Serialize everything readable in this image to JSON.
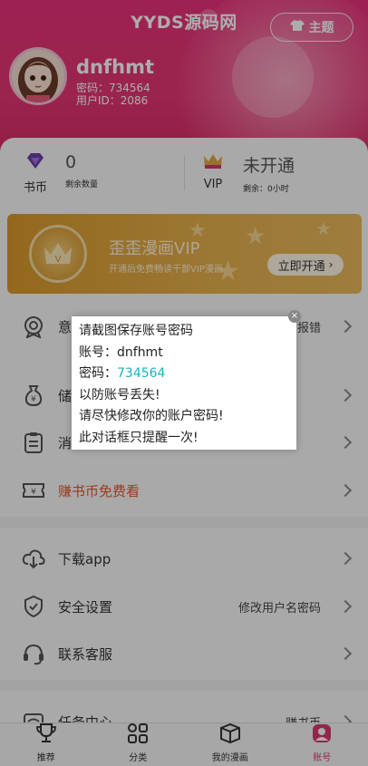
{
  "header": {
    "site_title": "YYDS源码网",
    "theme_label": "主题",
    "username": "dnfhmt",
    "password_line": "密码：734564",
    "user_id_line": "用户ID：2086"
  },
  "stats": {
    "coins": {
      "icon_label": "书币",
      "value": "0",
      "sub": "剩余数量"
    },
    "vip": {
      "icon_label": "VIP",
      "value": "未开通",
      "sub": "剩余：0小时"
    }
  },
  "vip_banner": {
    "title": "歪歪漫画VIP",
    "desc": "开通后免费畅读千部VIP漫画",
    "button": "立即开通"
  },
  "menu": [
    {
      "label": "意见反馈",
      "visible_label": "意",
      "right": "报错"
    },
    {
      "label": "储",
      "right": ""
    },
    {
      "label": "消",
      "right": ""
    },
    {
      "label": "赚书币免费看",
      "right": ""
    },
    {
      "label": "下载app",
      "right": ""
    },
    {
      "label": "安全设置",
      "right": "修改用户名密码"
    },
    {
      "label": "联系客服",
      "right": ""
    },
    {
      "label": "任务中心",
      "right": "赚书币"
    }
  ],
  "dialog": {
    "line1": "请截图保存账号密码",
    "account_prefix": "账号：",
    "account": "dnfhmt",
    "password_prefix": "密码：",
    "password": "734564",
    "line4": "以防账号丢失!",
    "line5": "请尽快修改你的账户密码!",
    "line6": "此对话框只提醒一次!"
  },
  "bottom_nav": [
    {
      "label": "推荐",
      "icon": "trophy-icon"
    },
    {
      "label": "分类",
      "icon": "category-icon"
    },
    {
      "label": "我的漫画",
      "icon": "book-icon"
    },
    {
      "label": "账号",
      "icon": "account-icon",
      "active": true
    }
  ],
  "colors": {
    "brand": "#e43574",
    "vip_gold": "#e0a944",
    "password_highlight": "#1bb0c4",
    "earn_coins": "#e0572c"
  }
}
